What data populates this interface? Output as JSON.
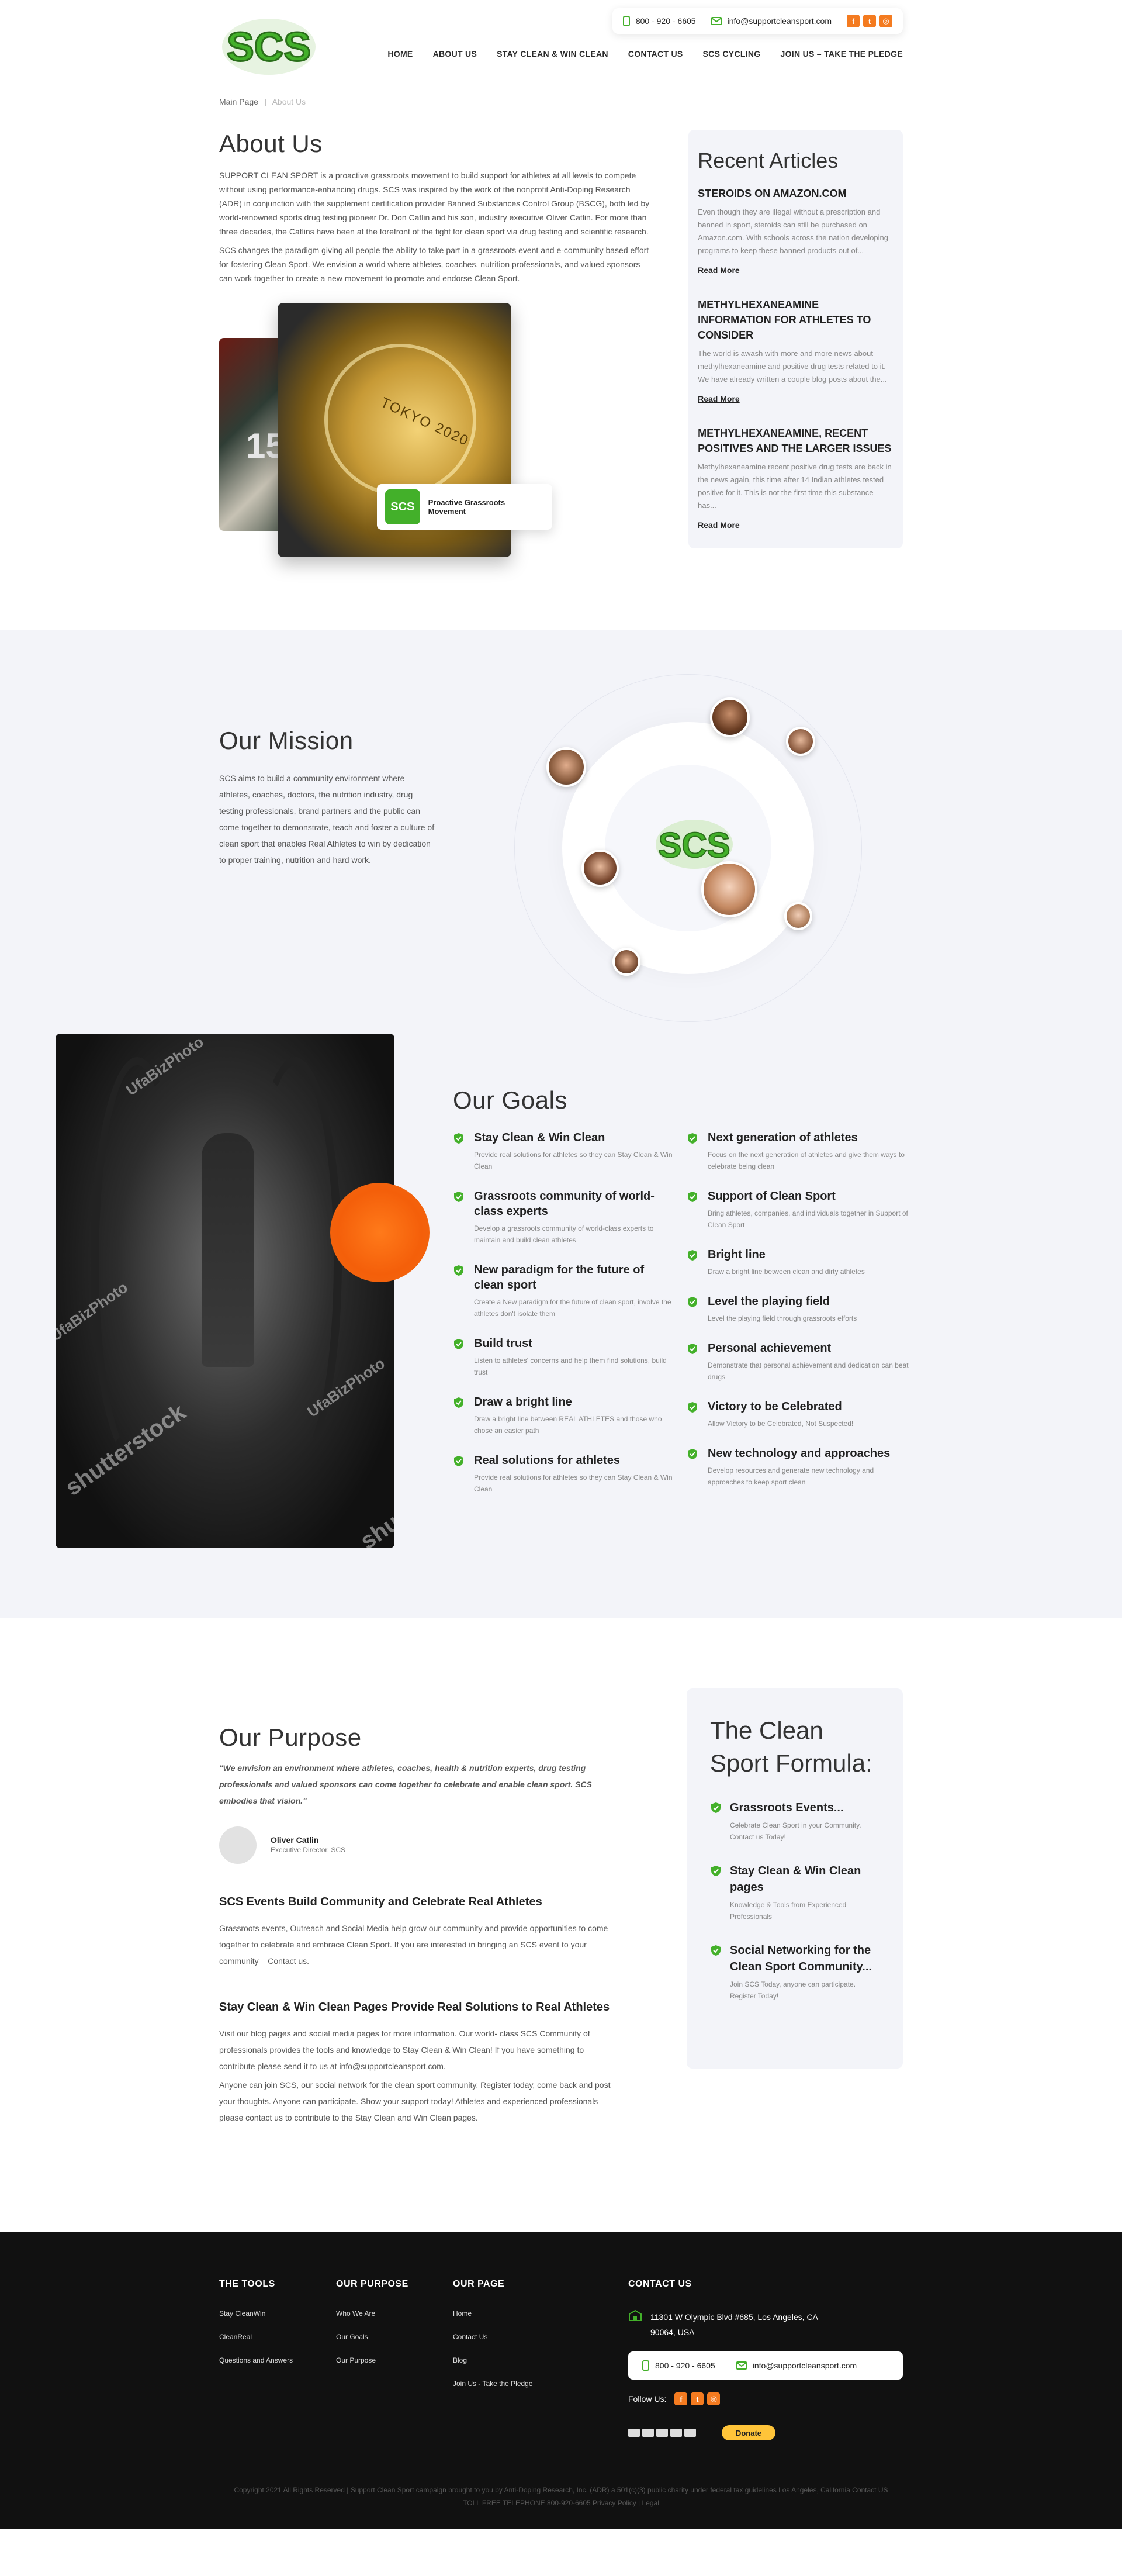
{
  "header": {
    "logo_text": "SCS",
    "phone": "800 - 920 - 6605",
    "email": "info@supportcleansport.com",
    "social": [
      "facebook-icon",
      "twitter-icon",
      "instagram-icon"
    ],
    "nav": [
      "HOME",
      "ABOUT US",
      "STAY CLEAN & WIN CLEAN",
      "CONTACT US",
      "SCS CYCLING",
      "JOIN US – TAKE THE PLEDGE"
    ]
  },
  "breadcrumb": {
    "home": "Main Page",
    "sep": "|",
    "current": "About Us"
  },
  "about": {
    "title": "About Us",
    "p1": "SUPPORT CLEAN SPORT is a proactive grassroots movement to build support for athletes at all levels to compete without using performance-enhancing drugs. SCS was inspired by the work of the nonprofit Anti-Doping Research (ADR) in conjunction with the supplement certification provider Banned Substances Control Group (BSCG), both led by world-renowned sports drug testing pioneer Dr. Don Catlin and his son, industry executive Oliver Catlin. For more than three decades, the Catlins have been at the forefront of the fight for clean sport via drug testing and scientific research.",
    "p2": "SCS changes the paradigm giving all people the ability to take part in a grassroots event and e-community based effort for fostering Clean Sport. We envision a world where athletes, coaches, nutrition professionals, and valued sponsors can work together to create a new movement to promote and endorse Clean Sport.",
    "badge": "SCS",
    "badge_label": "Proactive Grassroots Movement",
    "medal_text": "TOKYO 2020"
  },
  "recent": {
    "title": "Recent Articles",
    "read_more": "Read More",
    "articles": [
      {
        "title": "STEROIDS ON AMAZON.COM",
        "excerpt": "Even though they are illegal without a prescription and banned in sport, steroids can still be purchased on Amazon.com. With schools across the nation developing programs to keep these banned products out of..."
      },
      {
        "title": "METHYLHEXANEAMINE INFORMATION FOR ATHLETES TO CONSIDER",
        "excerpt": "The world is awash with more and more news about methylhexaneamine and positive drug tests related to it. We have already written a couple blog posts about the..."
      },
      {
        "title": "METHYLHEXANEAMINE, RECENT POSITIVES AND THE LARGER ISSUES",
        "excerpt": "Methylhexaneamine recent positive drug tests are back in the news again, this time after 14 Indian athletes tested positive for it. This is not the first time this substance has..."
      }
    ]
  },
  "mission": {
    "title": "Our Mission",
    "text": "SCS aims to build a community environment where athletes, coaches, doctors, the nutrition industry, drug testing professionals, brand partners and the public can come together to demonstrate, teach and foster a culture of clean sport that enables Real Athletes to win by dedication to proper training, nutrition and hard work."
  },
  "goals": {
    "title": "Our Goals",
    "watermarks": [
      "UfaBizPhoto",
      "UfaBizPhoto",
      "UfaBizPhoto",
      "shutterstock",
      "shu"
    ],
    "left": [
      {
        "title": "Stay Clean & Win Clean",
        "desc": "Provide real solutions for athletes so they can Stay Clean & Win Clean"
      },
      {
        "title": "Grassroots community of world-class experts",
        "desc": "Develop a grassroots community of world-class experts to maintain and build clean athletes"
      },
      {
        "title": "New paradigm for the future of clean sport",
        "desc": "Create a New paradigm for the future of clean sport, involve the athletes don't isolate them"
      },
      {
        "title": "Build trust",
        "desc": "Listen to athletes' concerns and help them find solutions, build trust"
      },
      {
        "title": "Draw a bright line",
        "desc": "Draw a bright line between REAL ATHLETES and those who chose an easier path"
      },
      {
        "title": "Real solutions for athletes",
        "desc": "Provide real solutions for athletes so they can Stay Clean & Win Clean"
      }
    ],
    "right": [
      {
        "title": "Next generation of athletes",
        "desc": "Focus on the next generation of athletes and give them ways to celebrate being clean"
      },
      {
        "title": "Support of Clean Sport",
        "desc": "Bring athletes, companies, and individuals together in Support of Clean Sport"
      },
      {
        "title": "Bright line",
        "desc": "Draw a bright line between clean and dirty athletes"
      },
      {
        "title": "Level the playing field",
        "desc": "Level the playing field through grassroots efforts"
      },
      {
        "title": "Personal achievement",
        "desc": "Demonstrate that personal achievement and dedication can beat drugs"
      },
      {
        "title": "Victory to be Celebrated",
        "desc": "Allow Victory to be Celebrated, Not Suspected!"
      },
      {
        "title": "New technology and approaches",
        "desc": "Develop resources and generate new technology and approaches to keep sport clean"
      }
    ]
  },
  "purpose": {
    "title": "Our Purpose",
    "quote": "\"We envision an environment where athletes, coaches, health & nutrition experts, drug testing professionals and valued sponsors can come together to celebrate and enable clean sport. SCS embodies that vision.\"",
    "author_name": "Oliver Catlin",
    "author_role": "Executive Director, SCS",
    "h1": "SCS Events Build Community and Celebrate Real Athletes",
    "p1": "Grassroots events, Outreach and Social Media help grow our community and provide opportunities to come together to celebrate and embrace Clean Sport. If you are interested in bringing an SCS event to your community – Contact us.",
    "h2": "Stay Clean & Win Clean Pages Provide Real Solutions to Real Athletes",
    "p2": "Visit our blog pages and social media pages for more information.  Our world- class SCS Community of professionals provides the tools and knowledge to Stay Clean & Win Clean! If you have something to contribute please send it to us at info@supportcleansport.com.",
    "p3": "Anyone can join SCS, our social network for the clean sport community. Register today, come back and post your thoughts. Anyone can participate. Show your support today! Athletes and experienced professionals please contact us to contribute to the Stay Clean and Win Clean pages."
  },
  "formula": {
    "title": "The Clean Sport Formula:",
    "items": [
      {
        "title": "Grassroots Events...",
        "desc": "Celebrate Clean Sport in your Community. Contact us Today!"
      },
      {
        "title": "Stay Clean & Win Clean pages",
        "desc": "Knowledge & Tools from Experienced Professionals"
      },
      {
        "title": "Social Networking for the Clean Sport Community...",
        "desc": "Join SCS Today, anyone can participate. Register Today!"
      }
    ]
  },
  "footer": {
    "tools": {
      "title": "THE TOOLS",
      "links": [
        "Stay CleanWin",
        "CleanReal",
        "Questions and Answers"
      ]
    },
    "purpose": {
      "title": "OUR PURPOSE",
      "links": [
        "Who We Are",
        "Our Goals",
        "Our Purpose"
      ]
    },
    "page": {
      "title": "OUR PAGE",
      "links": [
        "Home",
        "Contact Us",
        "Blog",
        "Join Us - Take the Pledge"
      ]
    },
    "contact": {
      "title": "CONTACT US",
      "address": "11301 W Olympic Blvd #685, Los Angeles, CA 90064, USA",
      "phone": "800 - 920 - 6605",
      "email": "info@supportcleansport.com",
      "follow": "Follow Us:",
      "donate": "Donate"
    },
    "copyright": "Copyright 2021 All Rights Reserved | Support Clean Sport campaign brought to you by Anti-Doping Research, Inc. (ADR) a 501(c)(3) public charity under federal tax guidelines Los Angeles, California Contact US TOLL FREE TELEPHONE 800-920-6605 Privacy Policy | Legal"
  },
  "colors": {
    "green": "#43b02a",
    "orange": "#f47b20",
    "dark": "#111111",
    "gray_bg": "#f3f4f9"
  }
}
